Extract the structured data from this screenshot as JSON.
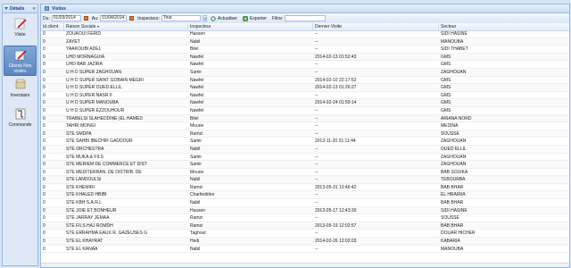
{
  "sidebar": {
    "title": "Détails",
    "collapse_glyph": "«",
    "items": [
      {
        "label": "Visite",
        "icon": "pencil-icon"
      },
      {
        "label": "Clients Non visités",
        "icon": "clients-icon"
      },
      {
        "label": "Inventaire",
        "icon": "inventory-icon"
      },
      {
        "label": "Commande",
        "icon": "order-icon"
      }
    ]
  },
  "main": {
    "tab_label": "Visites"
  },
  "toolbar": {
    "du_label": "Du:",
    "du_value": "01/03/2014",
    "au_label": "Au:",
    "au_value": "01/04/2014",
    "inspecteur_label": "Inspecteur:",
    "inspecteur_value": "Tout",
    "actualiser_label": "Actualiser",
    "exporter_label": "Exporter",
    "filtre_label": "Filtre:",
    "filtre_value": ""
  },
  "grid": {
    "columns": [
      "Id.client",
      "Raison Sociale",
      "Inspecteur",
      "Dernier Visite",
      "Secteur"
    ],
    "rows": [
      [
        "0",
        "ZOUAOUI FERID",
        "Hassen",
        "--",
        "SIDI HASINE"
      ],
      [
        "0",
        "ZAYET",
        "Nabil",
        "--",
        "MANOUBA"
      ],
      [
        "0",
        "YAAKOUBI ADEL",
        "Bilel",
        "--",
        "SIDI THABET"
      ],
      [
        "0",
        "UHD MORNAGUIA",
        "Nawfel",
        "2014-02-13 01:52:43",
        "GMS"
      ],
      [
        "0",
        "UHD BAB JAZIRA",
        "Nawfel",
        "--",
        "GMS"
      ],
      [
        "0",
        "U H D SUPER ZAGHOUAN",
        "Samir",
        "--",
        "ZAGHOUAN"
      ],
      [
        "0",
        "U H D SUPER SAINT GOBAIN MEGRI",
        "Nawfel",
        "2014-02-10 22:17:52",
        "GMS"
      ],
      [
        "0",
        "U H D SUPER OUED ELLIL",
        "Nawfel",
        "2014-02-13 01:26:27",
        "GMS"
      ],
      [
        "0",
        "U H D SUPER NASR II",
        "Nawfel",
        "--",
        "GMS"
      ],
      [
        "0",
        "U H D SUPER MANOUBA",
        "Nawfel",
        "2014-02-24 01:59:14",
        "GMS"
      ],
      [
        "0",
        "U H D SUPER EZZOUHOUR",
        "Nawfel",
        "--",
        "GMS"
      ],
      [
        "0",
        "TRABELSI SLAHEDDINE (EL HAMED",
        "Bilel",
        "--",
        "ARIANA NORD"
      ],
      [
        "0",
        "TAHRI MONGI",
        "Mourie",
        "--",
        "MEDINA"
      ],
      [
        "0",
        "STE SMDPA",
        "Ramzi",
        "--",
        "SOUSSE"
      ],
      [
        "0",
        "STE SAHBI IBECHIR GADDOUR",
        "Samir",
        "2013-11-20 21:11:44",
        "ZAGHOUAN"
      ],
      [
        "0",
        "STE ORCHESTRA",
        "Nabil",
        "--",
        "OUED ELLIL"
      ],
      [
        "0",
        "STE MUKA & FILS",
        "Samir",
        "--",
        "ZAGHOUAN"
      ],
      [
        "0",
        "STE MERIEM DE COMMERCE ET DIST",
        "Samir",
        "--",
        "ZAGHOUAN"
      ],
      [
        "0",
        "STE MEDITERRAN. DE DISTRIB. DE",
        "Mourie",
        "--",
        "BAB SOUIKA"
      ],
      [
        "0",
        "STE LANDOULSI",
        "Nabil",
        "--",
        "TEBOURBA"
      ],
      [
        "0",
        "STE KHEMIRI",
        "Ramzi",
        "2013-05-31 13:46:42",
        "BAB BHAR"
      ],
      [
        "0",
        "STE KHALED HBIBI",
        "Charfeddine",
        "--",
        "EL HRAIRIA"
      ],
      [
        "0",
        "STE KBH S.A.R.L",
        "Nabil",
        "--",
        "BAB BHAR"
      ],
      [
        "0",
        "STE JOIE ET BONHEUR",
        "Hassen",
        "2013-05-17 12:43:30",
        "SIDI HASINE"
      ],
      [
        "0",
        "STE JARRAY JEMAA",
        "Ramzi",
        "--",
        "SOUSSE"
      ],
      [
        "0",
        "STE FILS HAJ ROMDH",
        "Ramzi",
        "2013-05-19 12:02:57",
        "BAB BHAR"
      ],
      [
        "0",
        "STE ERRAHMA EAUX R. GAZEUSES G",
        "Taghout",
        "--",
        "DOUAR HICHER"
      ],
      [
        "0",
        "STE EL KHAYRAT",
        "Hedi",
        "2014-02-26 13:02:03",
        "KABARIA"
      ],
      [
        "0",
        "STE EL KANAA",
        "Nabil",
        "--",
        "MANOUBA"
      ]
    ]
  },
  "colors": {
    "header_bar": "#cddbef",
    "border": "#99bbe8",
    "active_nav": "#5a87c0",
    "title_text": "#15428b"
  }
}
